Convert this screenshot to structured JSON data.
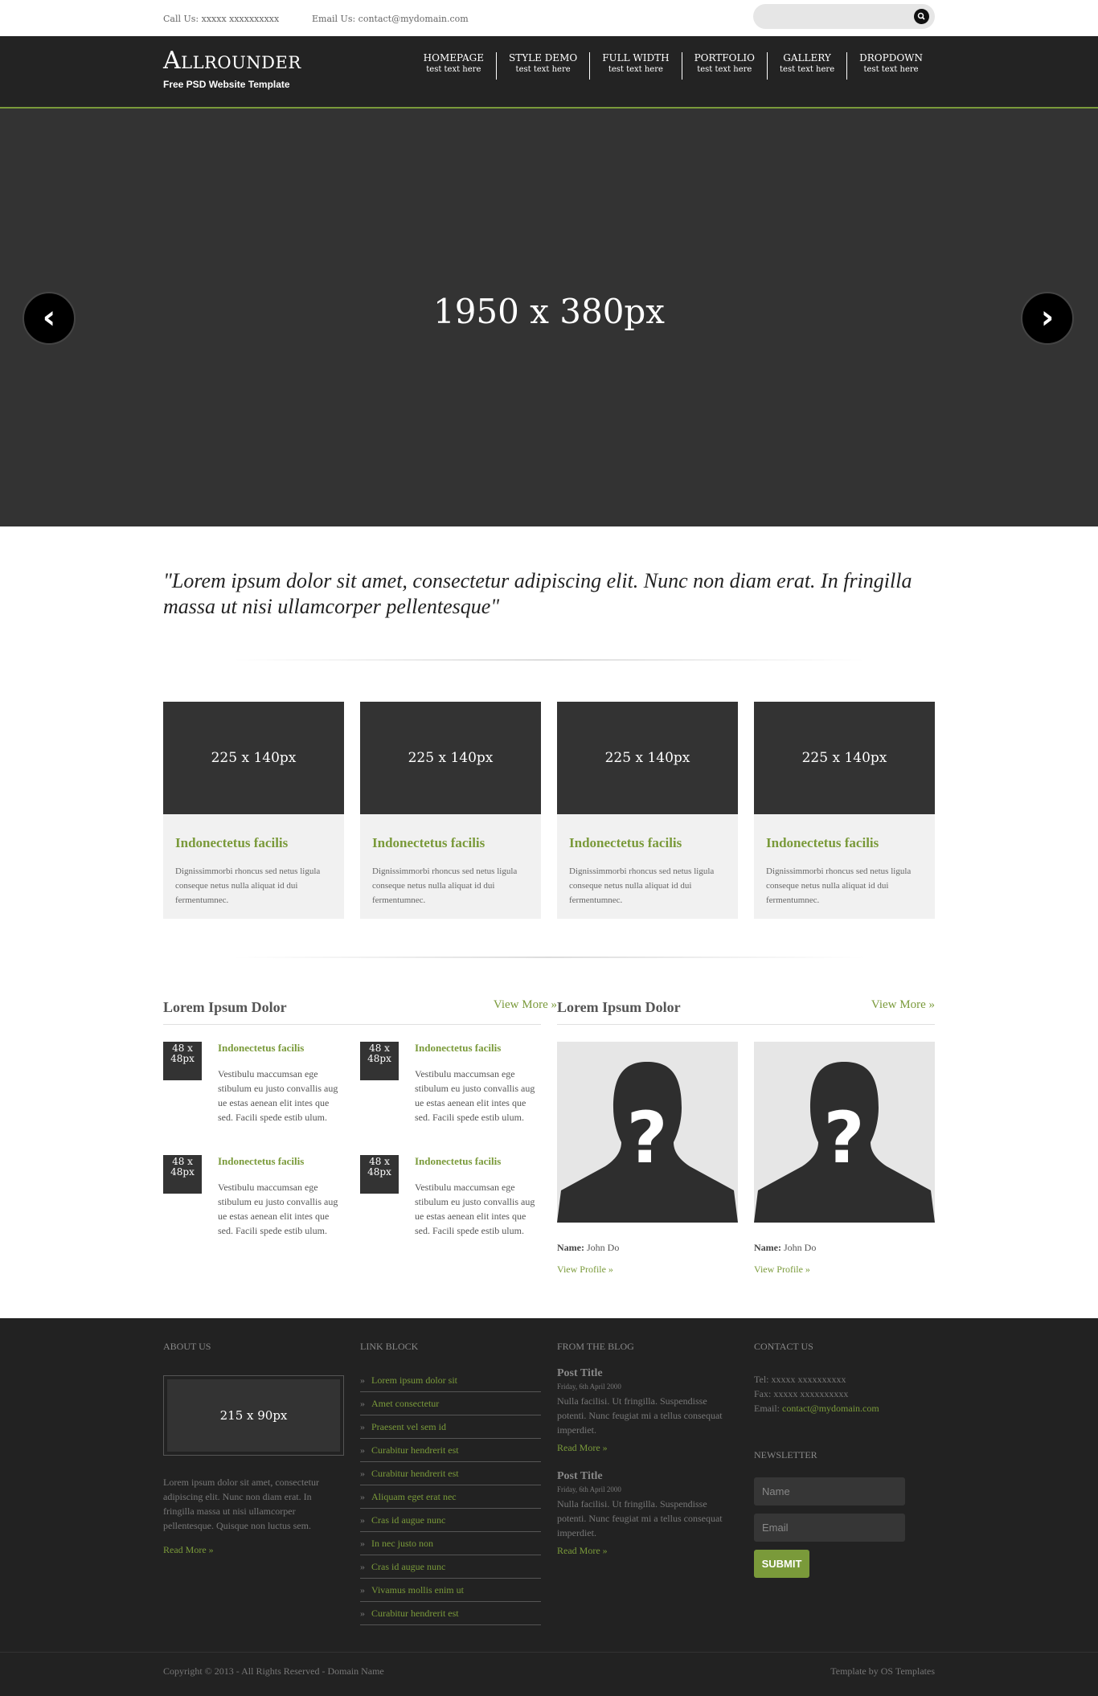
{
  "topbar": {
    "call": "Call Us: xxxxx xxxxxxxxxx",
    "email": "Email Us: contact@mydomain.com",
    "search_placeholder": ""
  },
  "header": {
    "logo": "Allrounder",
    "tagline": "Free PSD Website Template",
    "nav": [
      {
        "label": "HOMEPAGE",
        "sub": "test text here"
      },
      {
        "label": "STYLE DEMO",
        "sub": "test text here"
      },
      {
        "label": "FULL WIDTH",
        "sub": "test text here"
      },
      {
        "label": "PORTFOLIO",
        "sub": "test text here"
      },
      {
        "label": "GALLERY",
        "sub": "test text here"
      },
      {
        "label": "DROPDOWN",
        "sub": "test text here"
      }
    ]
  },
  "slider": {
    "label": "1950 x 380px",
    "prev": "‹",
    "next": "›"
  },
  "quote": "\"Lorem ipsum dolor sit amet, consectetur adipiscing elit. Nunc non diam erat. In fringilla massa ut nisi ullamcorper pellentesque\"",
  "cards": [
    {
      "img": "225 x 140px",
      "title": "Indonectetus facilis",
      "text": "Dignissimmorbi rhoncus sed netus ligula conseque netus nulla aliquat id dui fermentumnec."
    },
    {
      "img": "225 x 140px",
      "title": "Indonectetus facilis",
      "text": "Dignissimmorbi rhoncus sed netus ligula conseque netus nulla aliquat id dui fermentumnec."
    },
    {
      "img": "225 x 140px",
      "title": "Indonectetus facilis",
      "text": "Dignissimmorbi rhoncus sed netus ligula conseque netus nulla aliquat id dui fermentumnec."
    },
    {
      "img": "225 x 140px",
      "title": "Indonectetus facilis",
      "text": "Dignissimmorbi rhoncus sed netus ligula conseque netus nulla aliquat id dui fermentumnec."
    }
  ],
  "left_section": {
    "title": "Lorem Ipsum Dolor",
    "more": "View More »",
    "posts": [
      {
        "thumb": "48 x 48px",
        "title": "Indonectetus facilis",
        "text": "Vestibulu maccumsan ege stibulum eu justo convallis aug ue estas aenean elit intes que sed. Facili spede estib ulum."
      },
      {
        "thumb": "48 x 48px",
        "title": "Indonectetus facilis",
        "text": "Vestibulu maccumsan ege stibulum eu justo convallis aug ue estas aenean elit intes que sed. Facili spede estib ulum."
      },
      {
        "thumb": "48 x 48px",
        "title": "Indonectetus facilis",
        "text": "Vestibulu maccumsan ege stibulum eu justo convallis aug ue estas aenean elit intes que sed. Facili spede estib ulum."
      },
      {
        "thumb": "48 x 48px",
        "title": "Indonectetus facilis",
        "text": "Vestibulu maccumsan ege stibulum eu justo convallis aug ue estas aenean elit intes que sed. Facili spede estib ulum."
      }
    ]
  },
  "right_section": {
    "title": "Lorem Ipsum Dolor",
    "more": "View More »",
    "people": [
      {
        "name_label": "Name:",
        "name": " John Do",
        "link": "View Profile »"
      },
      {
        "name_label": "Name:",
        "name": " John Do",
        "link": "View Profile »"
      }
    ]
  },
  "footer": {
    "about": {
      "title": "ABOUT US",
      "img": "215 x 90px",
      "text": "Lorem ipsum dolor sit amet, consectetur adipiscing elit. Nunc non diam erat. In fringilla massa ut nisi ullamcorper pellentesque. Quisque non luctus sem.",
      "read_more": "Read More »"
    },
    "links": {
      "title": "LINK BLOCK",
      "bullet": "»",
      "items": [
        "Lorem ipsum dolor sit",
        "Amet consectetur",
        "Praesent vel sem id",
        "Curabitur hendrerit est",
        "Curabitur hendrerit est",
        "Aliquam eget erat nec",
        "Cras id augue nunc",
        "In nec justo non",
        "Cras id augue nunc",
        "Vivamus mollis enim ut",
        "Curabitur hendrerit est"
      ]
    },
    "blog": {
      "title": "FROM THE BLOG",
      "posts": [
        {
          "title": "Post Title",
          "date": "Friday, 6th April 2000",
          "text": "Nulla facilisi. Ut fringilla. Suspendisse potenti. Nunc feugiat mi a tellus consequat imperdiet.",
          "read_more": "Read More »"
        },
        {
          "title": "Post Title",
          "date": "Friday, 6th April 2000",
          "text": "Nulla facilisi. Ut fringilla. Suspendisse potenti. Nunc feugiat mi a tellus consequat imperdiet.",
          "read_more": "Read More »"
        }
      ]
    },
    "contact": {
      "title": "CONTACT US",
      "tel": "Tel: xxxxx xxxxxxxxxx",
      "fax": "Fax: xxxxx xxxxxxxxxx",
      "email_label": "Email: ",
      "email": "contact@mydomain.com",
      "newsletter_title": "NEWSLETTER",
      "name_placeholder": "Name",
      "email_placeholder": "Email",
      "submit": "SUBMIT"
    },
    "copyright": "Copyright © 2013 - All Rights Reserved - Domain Name",
    "credit": "Template by OS Templates"
  },
  "colors": {
    "accent": "#7a9a3a",
    "dark": "#333333",
    "header_bg": "#232323",
    "footer_bg": "#222222"
  }
}
